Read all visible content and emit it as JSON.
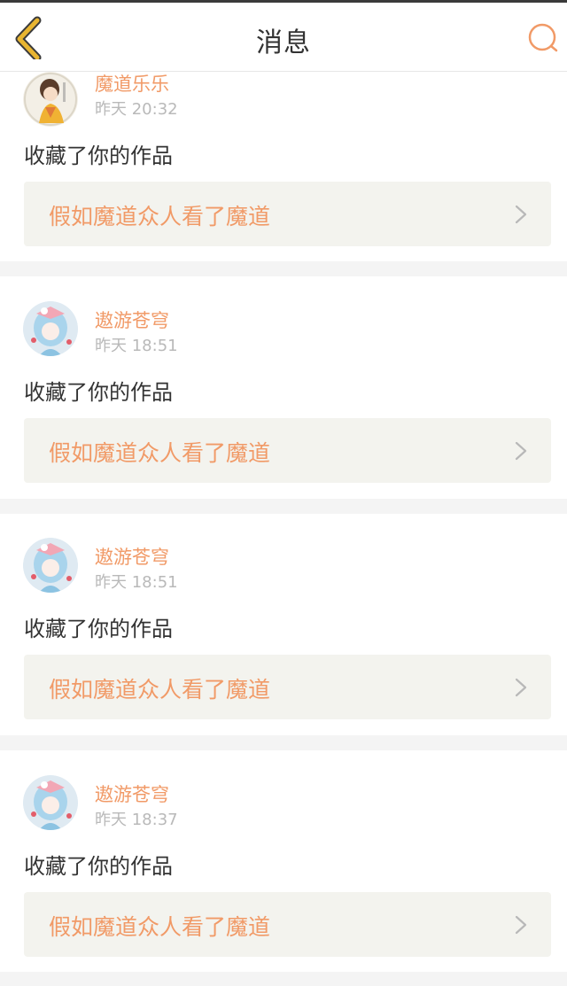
{
  "header": {
    "title": "消息",
    "accent_color": "#f19a67",
    "back_icon": "chevron-left-icon",
    "search_icon": "search-icon"
  },
  "notifications": [
    {
      "user": "魔道乐乐",
      "time": "昨天 20:32",
      "action": "收藏了你的作品",
      "work_title": "假如魔道众人看了魔道"
    },
    {
      "user": "遨游苍穹",
      "time": "昨天 18:51",
      "action": "收藏了你的作品",
      "work_title": "假如魔道众人看了魔道"
    },
    {
      "user": "遨游苍穹",
      "time": "昨天 18:51",
      "action": "收藏了你的作品",
      "work_title": "假如魔道众人看了魔道"
    },
    {
      "user": "遨游苍穹",
      "time": "昨天 18:37",
      "action": "收藏了你的作品",
      "work_title": "假如魔道众人看了魔道"
    }
  ]
}
